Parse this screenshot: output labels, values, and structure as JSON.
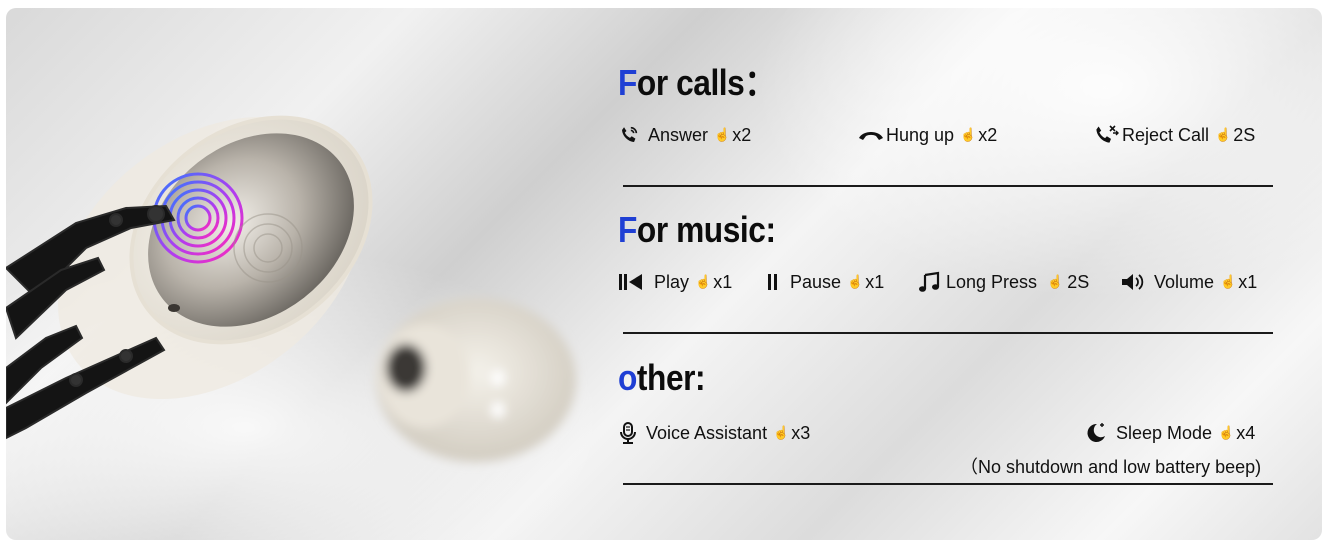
{
  "calls": {
    "heading_first": "F",
    "heading_rest": "or calls：",
    "items": [
      {
        "icon": "phone-ringing-icon",
        "label": "Answer",
        "gesture": "x2"
      },
      {
        "icon": "hang-up-icon",
        "label": "Hung up",
        "gesture": "x2"
      },
      {
        "icon": "reject-call-icon",
        "label": "Reject Call",
        "gesture": "2S"
      }
    ]
  },
  "music": {
    "heading_first": "F",
    "heading_rest": "or music:",
    "items": [
      {
        "icon": "play-previous-icon",
        "label": "Play",
        "gesture": "x1"
      },
      {
        "icon": "pause-icon",
        "label": "Pause",
        "gesture": "x1"
      },
      {
        "icon": "music-note-icon",
        "label": "Long Press",
        "gesture": "2S"
      },
      {
        "icon": "volume-icon",
        "label": "Volume",
        "gesture": "x1"
      }
    ]
  },
  "other": {
    "heading_first": "o",
    "heading_rest": "ther:",
    "items": [
      {
        "icon": "microphone-icon",
        "label": "Voice Assistant",
        "gesture": "x3"
      },
      {
        "icon": "moon-icon",
        "label": "Sleep Mode",
        "gesture": "x4"
      }
    ],
    "note": "（No shutdown and low battery beep)"
  },
  "colors": {
    "accent": "#1f3fd4",
    "text": "#111111",
    "divider": "#1a1a1a"
  }
}
